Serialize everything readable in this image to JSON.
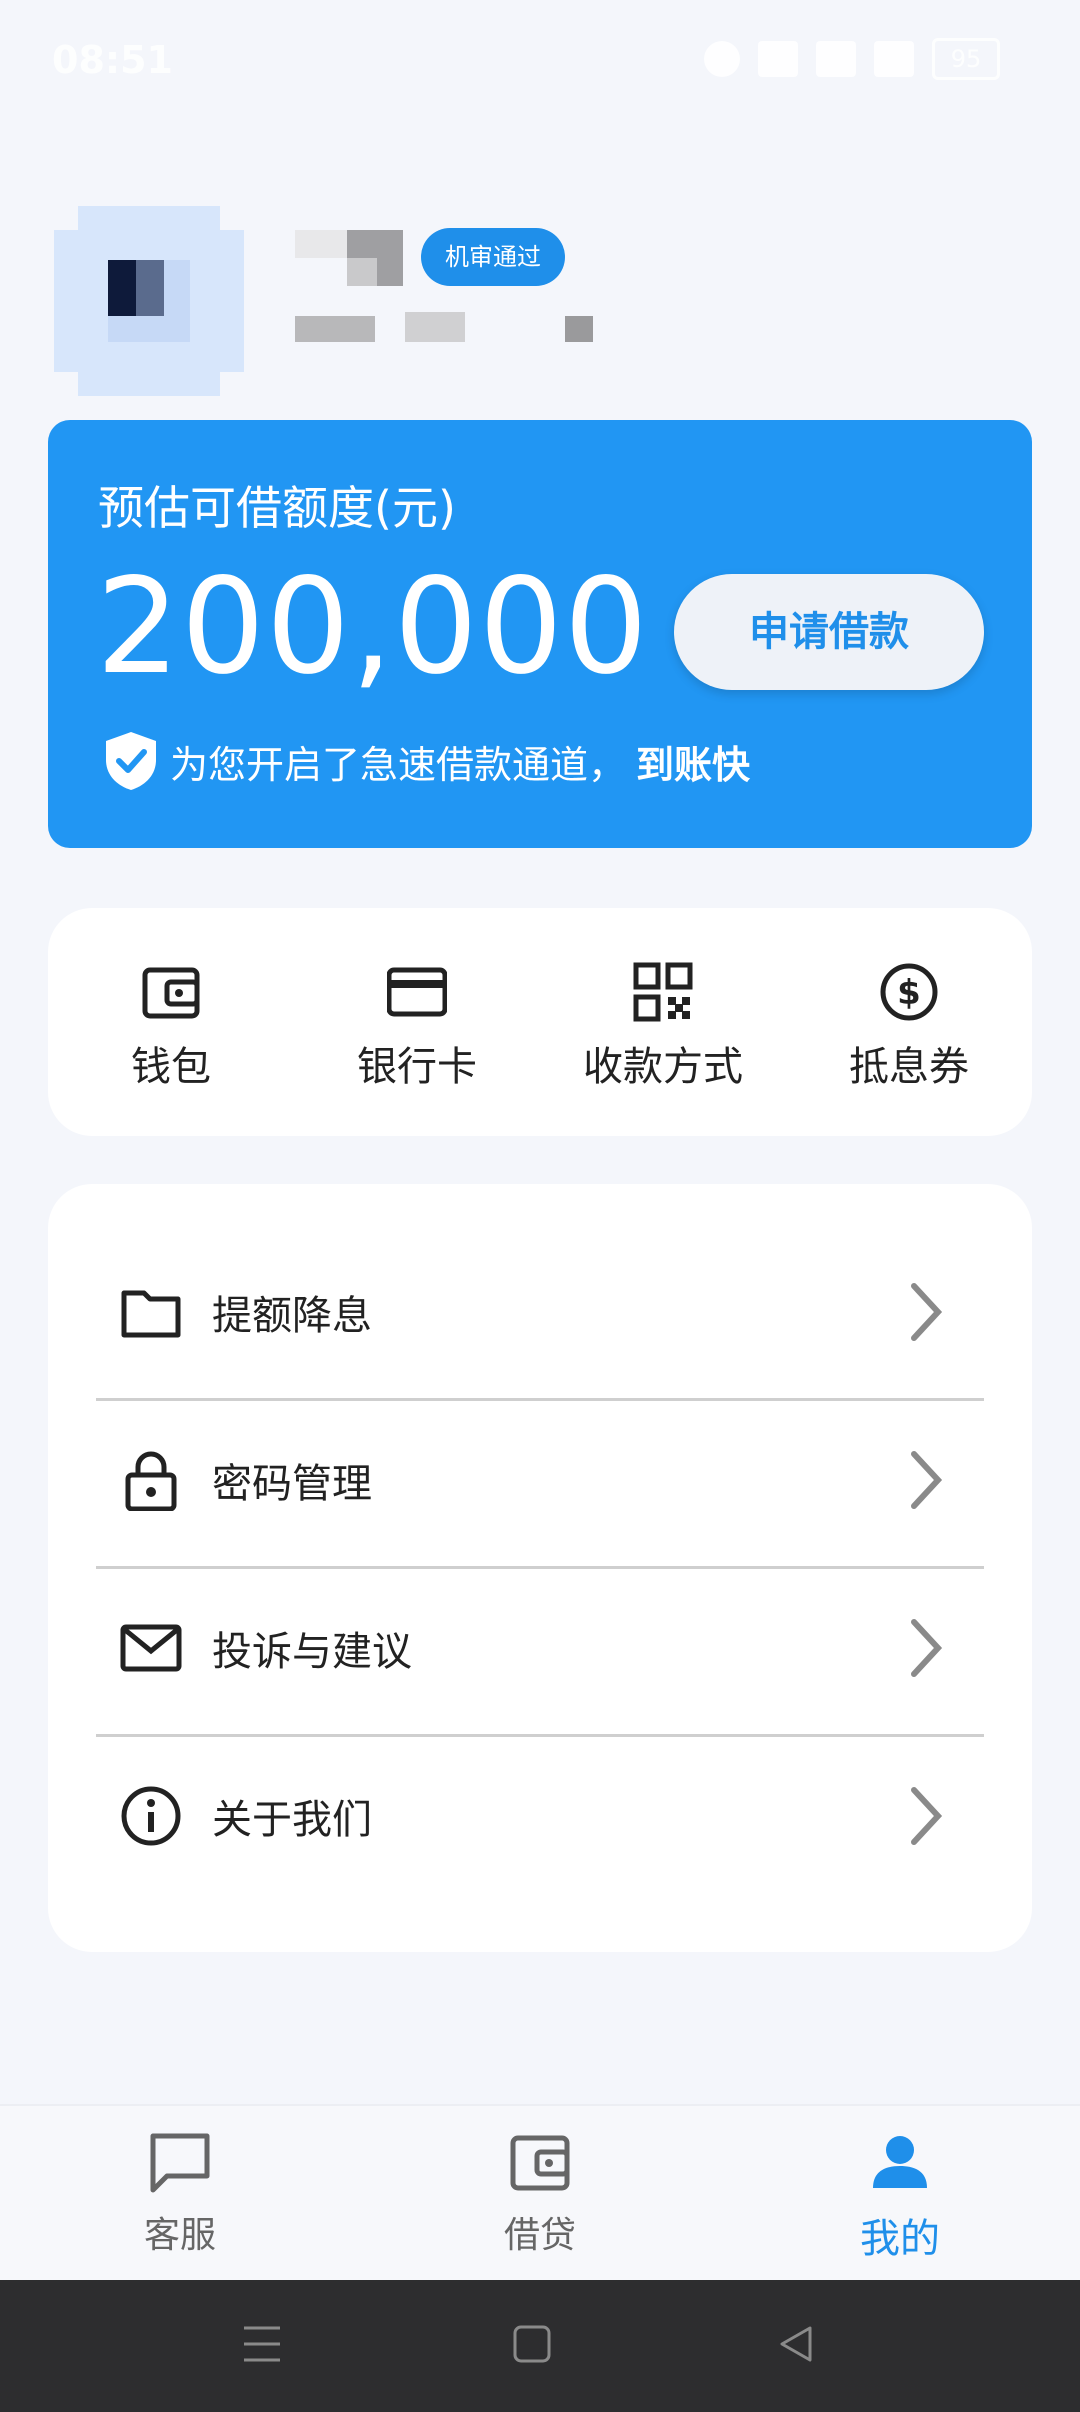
{
  "status_bar": {
    "time": "08:51",
    "battery": "95"
  },
  "profile": {
    "badge": "机审通过"
  },
  "credit": {
    "label": "预估可借额度(元)",
    "amount": "200,000",
    "apply_button": "申请借款",
    "notice_text": "为您开启了急速借款通道，",
    "notice_strong": "到账快",
    "accent_color": "#2196f3"
  },
  "quick_actions": [
    {
      "label": "钱包",
      "icon": "wallet-icon"
    },
    {
      "label": "银行卡",
      "icon": "credit-card-icon"
    },
    {
      "label": "收款方式",
      "icon": "qr-code-icon"
    },
    {
      "label": "抵息券",
      "icon": "dollar-coin-icon"
    }
  ],
  "menu": [
    {
      "label": "提额降息",
      "icon": "folder-icon"
    },
    {
      "label": "密码管理",
      "icon": "lock-icon"
    },
    {
      "label": "投诉与建议",
      "icon": "mail-icon"
    },
    {
      "label": "关于我们",
      "icon": "info-icon"
    }
  ],
  "bottom_nav": [
    {
      "label": "客服",
      "icon": "chat-icon",
      "active": false
    },
    {
      "label": "借贷",
      "icon": "wallet-icon",
      "active": false
    },
    {
      "label": "我的",
      "icon": "person-icon",
      "active": true
    }
  ]
}
